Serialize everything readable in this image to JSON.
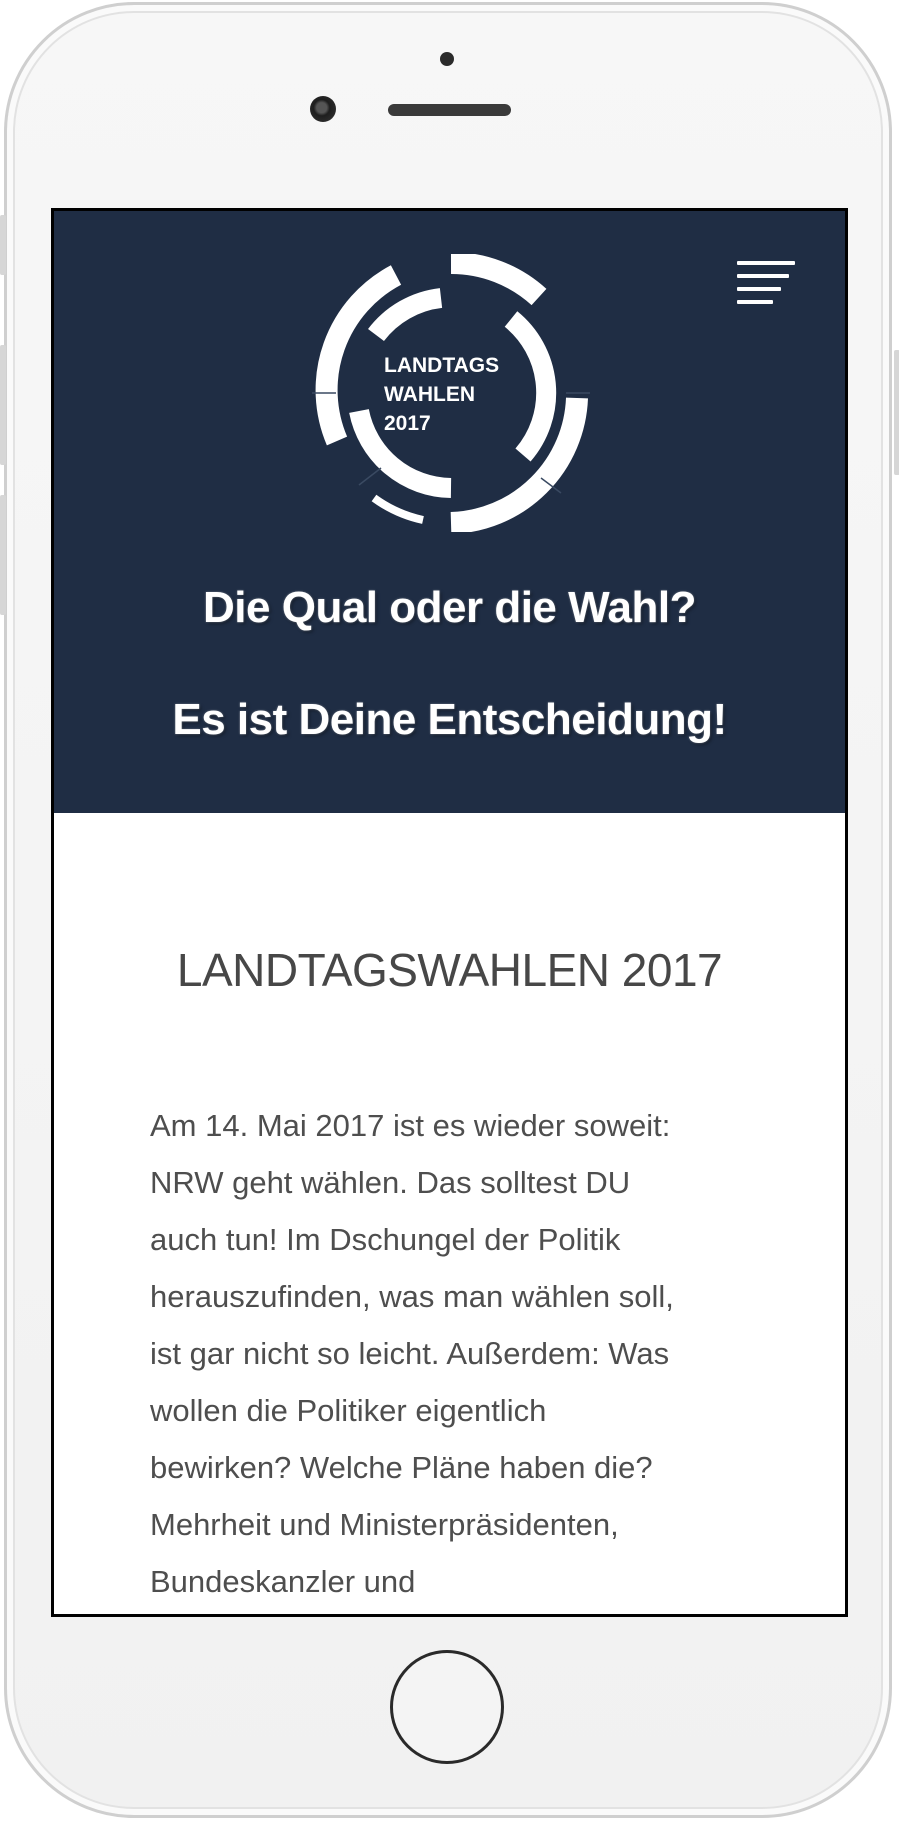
{
  "logo": {
    "lines": [
      "LANDTAGS",
      "WAHLEN",
      "2017"
    ]
  },
  "hero": {
    "headline_1": "Die Qual oder die Wahl?",
    "headline_2": "Es ist Deine Entscheidung!"
  },
  "content": {
    "title": "LANDTAGSWAHLEN 2017",
    "body_lines": [
      "Am 14. Mai 2017 ist es wieder soweit:",
      "NRW geht wählen. Das solltest DU",
      "auch tun! Im Dschungel der Politik",
      "herauszufinden, was man wählen soll,",
      "ist gar nicht so leicht. Außerdem: Was",
      "wollen die Politiker eigentlich",
      "bewirken? Welche Pläne haben die?",
      "Mehrheit und Ministerpräsidenten,",
      "Bundeskanzler und"
    ]
  },
  "icons": {
    "menu": "hamburger-menu-icon",
    "home": "home-button"
  },
  "colors": {
    "hero_background": "#1f2d44",
    "hero_text": "#ffffff",
    "title_text": "#474747",
    "body_text": "#4e4e4e"
  }
}
